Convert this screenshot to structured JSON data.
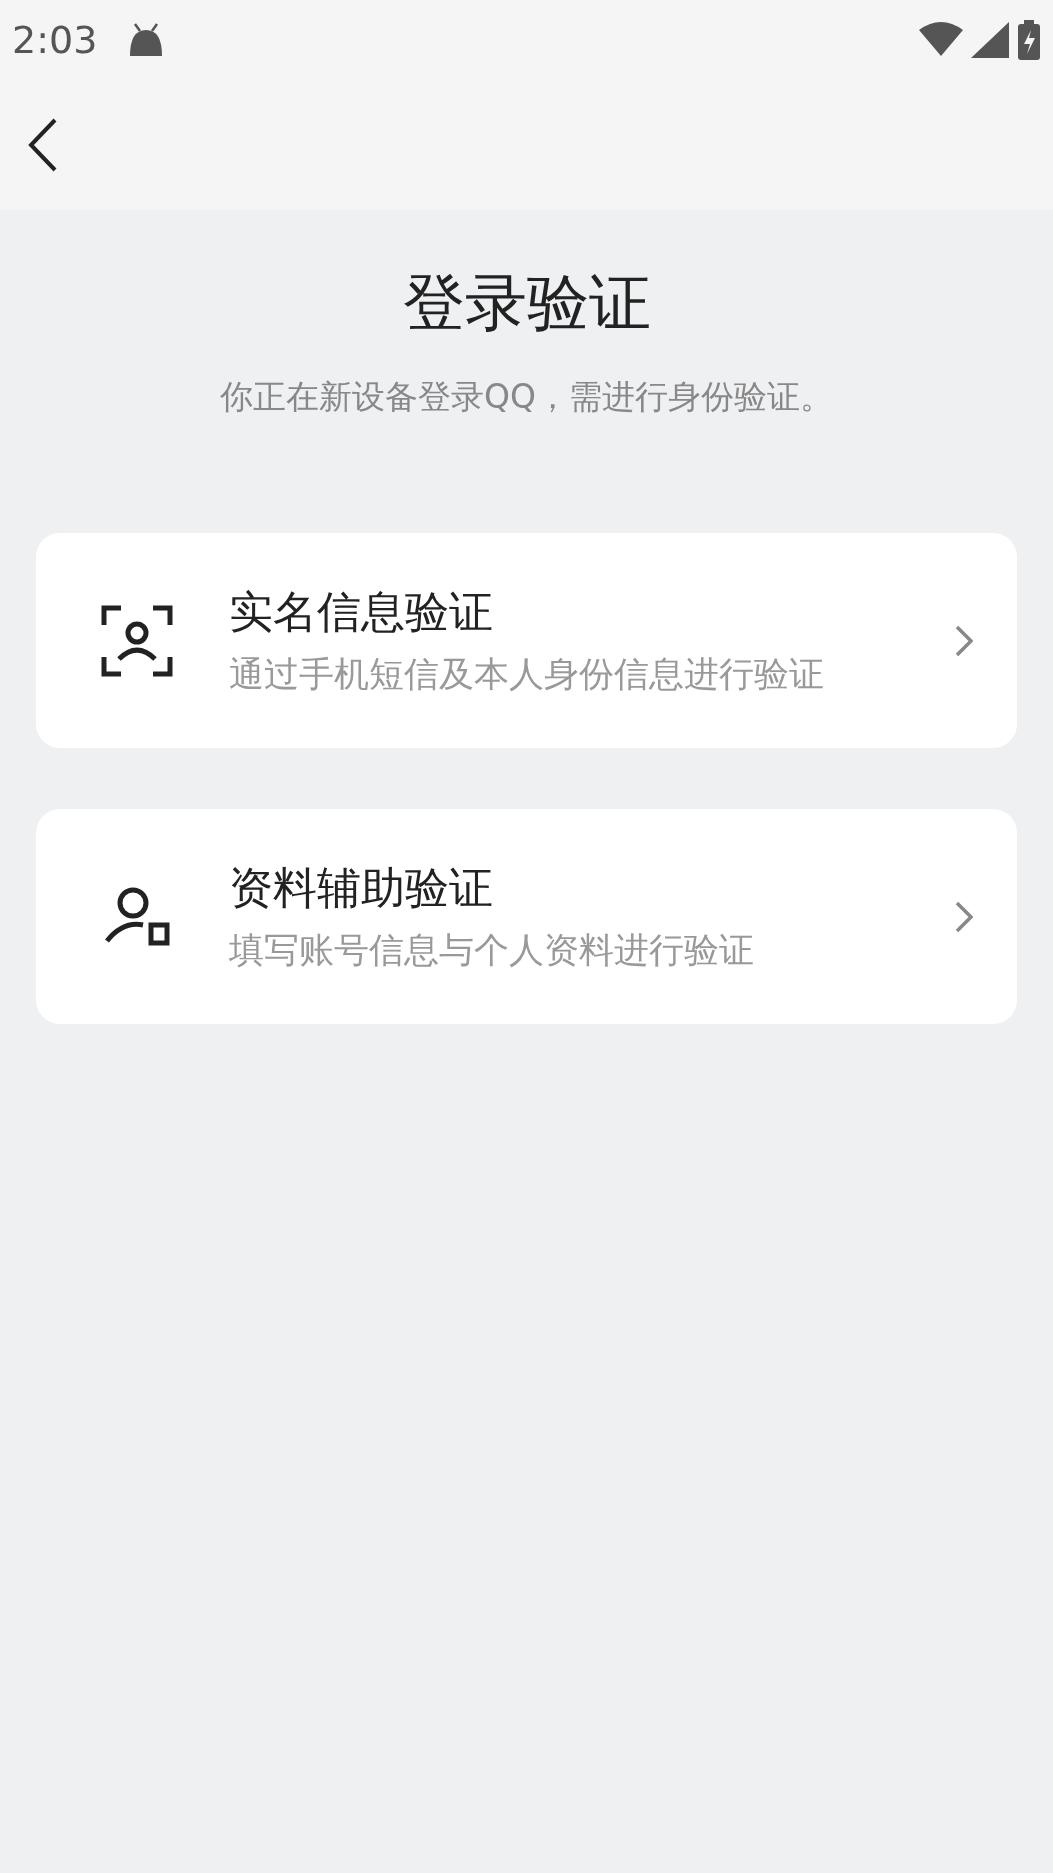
{
  "status_bar": {
    "time": "2:03"
  },
  "title": "登录验证",
  "subtitle": "你正在新设备登录QQ，需进行身份验证。",
  "options": [
    {
      "kind": "face",
      "title": "实名信息验证",
      "description": "通过手机短信及本人身份信息进行验证"
    },
    {
      "kind": "profile",
      "title": "资料辅助验证",
      "description": "填写账号信息与个人资料进行验证"
    }
  ]
}
